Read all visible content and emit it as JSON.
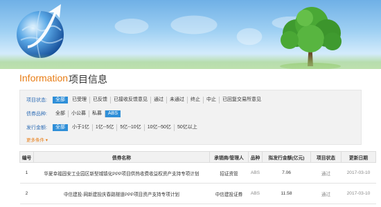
{
  "header": {
    "title_en": "Information",
    "title_cn": "项目信息"
  },
  "filters": {
    "rows": [
      {
        "label": "项目状态:",
        "options": [
          "全部",
          "已受理",
          "已反馈",
          "已接收反馈意见",
          "通过",
          "未通过",
          "终止",
          "中止",
          "已回复交易所意见"
        ],
        "active": 0
      },
      {
        "label": "债券品种:",
        "options": [
          "全部",
          "小公募",
          "私募",
          "ABS"
        ],
        "active": 3
      },
      {
        "label": "发行金额:",
        "options": [
          "全部",
          "小于1亿",
          "1亿--5亿",
          "5亿--10亿",
          "10亿--50亿",
          "50亿以上"
        ],
        "active": 0
      }
    ],
    "more_label": "更多条件 ▾"
  },
  "table": {
    "headers": [
      "编号",
      "债券名称",
      "承销商/管理人",
      "品种",
      "拟发行金额(亿元)",
      "项目状态",
      "更新日期"
    ],
    "rows": [
      [
        "1",
        "华夏幸福固安工业园区新型城镇化PPP项目供热收费收益权资产支持专项计划",
        "招证资管",
        "ABS",
        "7.06",
        "通过",
        "2017-03-10"
      ],
      [
        "2",
        "中信建投-网新建投庆春路隧道PPP项目资产支持专项计划",
        "中信建投证券",
        "ABS",
        "11.58",
        "通过",
        "2017-03-10"
      ]
    ]
  },
  "colors": {
    "accent_orange": "#e87d16",
    "label_blue": "#2f6db5",
    "active_blue": "#2f8fd8"
  }
}
